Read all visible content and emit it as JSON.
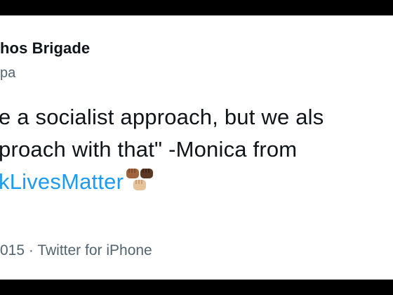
{
  "tweet": {
    "author_name": "hos Brigade",
    "author_handle": "pa",
    "text_lines": [
      "e a socialist approach, but we als",
      "proach with that\" -Monica from"
    ],
    "hashtag": "kLivesMatter",
    "emoji": {
      "name": "raised-fists-icon",
      "skin_tones": [
        "#a0643c",
        "#5a3825",
        "#e6c39b"
      ]
    },
    "meta": "015 · Twitter for iPhone"
  },
  "colors": {
    "text": "#0f1419",
    "secondary": "#536471",
    "link": "#1d9bf0",
    "background": "#ffffff",
    "letterbox": "#000000"
  }
}
